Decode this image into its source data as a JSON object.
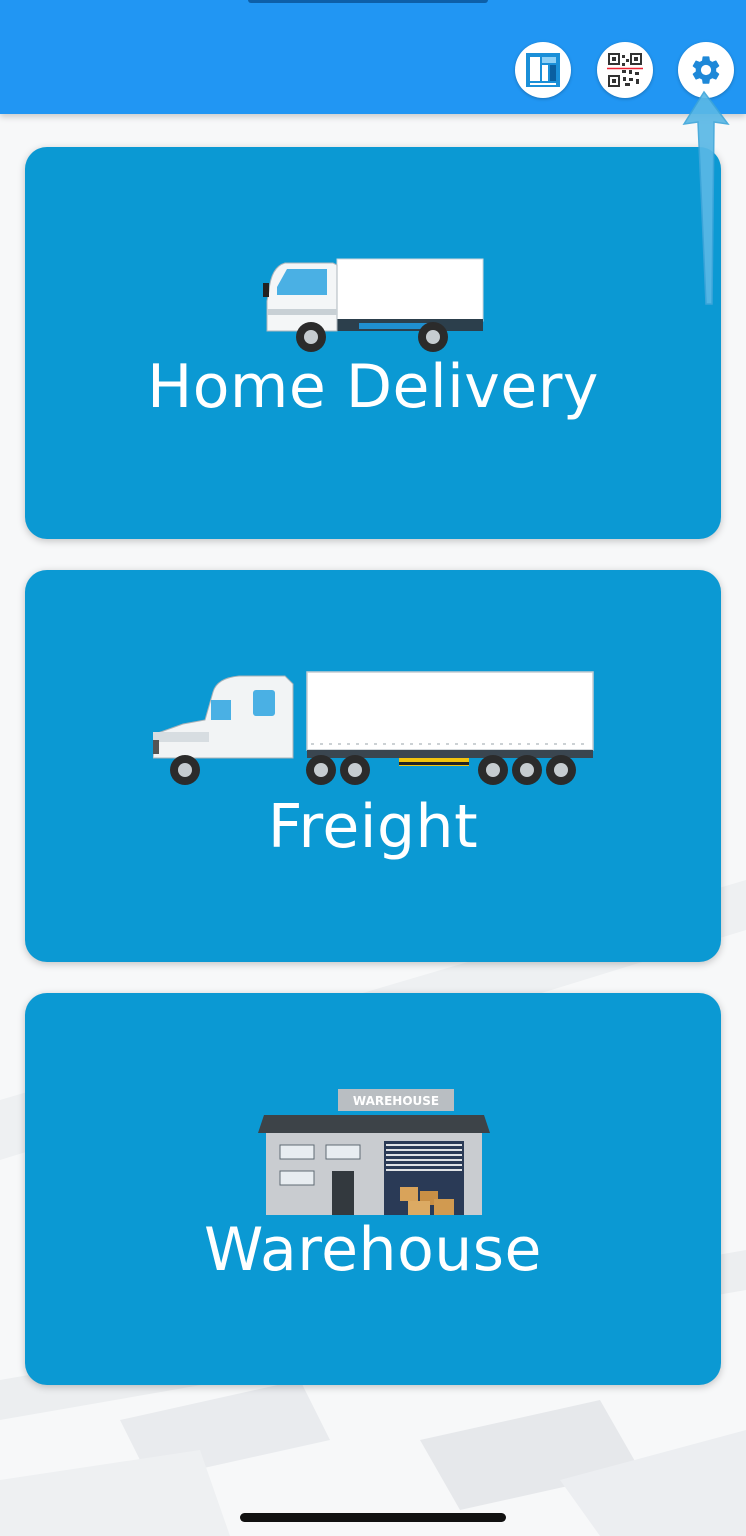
{
  "header": {
    "icons": [
      {
        "name": "layout-icon"
      },
      {
        "name": "qr-code-icon"
      },
      {
        "name": "settings-gear-icon"
      }
    ]
  },
  "cards": [
    {
      "label": "Home Delivery",
      "illustration": "delivery-truck"
    },
    {
      "label": "Freight",
      "illustration": "semi-truck"
    },
    {
      "label": "Warehouse",
      "illustration": "warehouse-building",
      "sign_text": "WAREHOUSE"
    }
  ],
  "colors": {
    "topbar": "#2196f3",
    "card": "#0b99d3",
    "text": "#ffffff"
  }
}
